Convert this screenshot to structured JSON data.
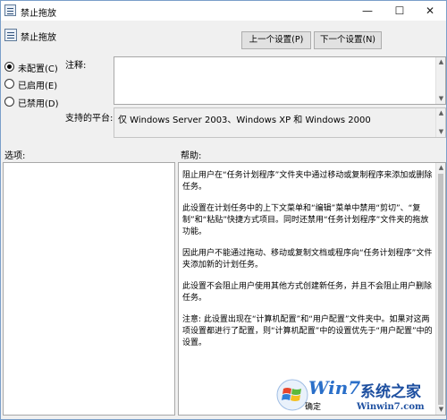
{
  "window": {
    "title": "禁止拖放",
    "controls": {
      "minimize": "—",
      "maximize": "☐",
      "close": "✕"
    }
  },
  "header": {
    "title": "禁止拖放",
    "prev_button": "上一个设置(P)",
    "next_button": "下一个设置(N)"
  },
  "state": {
    "options": [
      {
        "label": "未配置(C)",
        "checked": true
      },
      {
        "label": "已启用(E)",
        "checked": false
      },
      {
        "label": "已禁用(D)",
        "checked": false
      }
    ]
  },
  "comment": {
    "label": "注释:",
    "value": ""
  },
  "platform": {
    "label": "支持的平台:",
    "value": "仅 Windows Server 2003、Windows XP 和 Windows 2000"
  },
  "options_pane": {
    "label": "选项:"
  },
  "help_pane": {
    "label": "帮助:",
    "paragraphs": [
      "阻止用户在“任务计划程序”文件夹中通过移动或复制程序来添加或删除任务。",
      "此设置在计划任务中的上下文菜单和“编辑”菜单中禁用“剪切”、“复制”和“粘贴”快捷方式项目。同时还禁用“任务计划程序”文件夹的拖放功能。",
      "因此用户不能通过拖动、移动或复制文档或程序向“任务计划程序”文件夹添加新的计划任务。",
      "此设置不会阻止用户使用其他方式创建新任务，并且不会阻止用户删除任务。",
      "注意: 此设置出现在“计算机配置”和“用户配置”文件夹中。如果对这两项设置都进行了配置，则“计算机配置”中的设置优先于“用户配置”中的设置。"
    ]
  },
  "watermark": {
    "brand": "Win7",
    "site_name": "系统之家",
    "url": "Winwin7.com",
    "clipped_button": "确定"
  },
  "colors": {
    "window_bg": "#f0f0f0",
    "border": "#a8a8a8",
    "watermark_blue": "#1d4fa0"
  },
  "icons": [
    "policy-setting-icon",
    "minimize-icon",
    "maximize-icon",
    "close-icon",
    "scroll-up-icon",
    "scroll-down-icon"
  ]
}
